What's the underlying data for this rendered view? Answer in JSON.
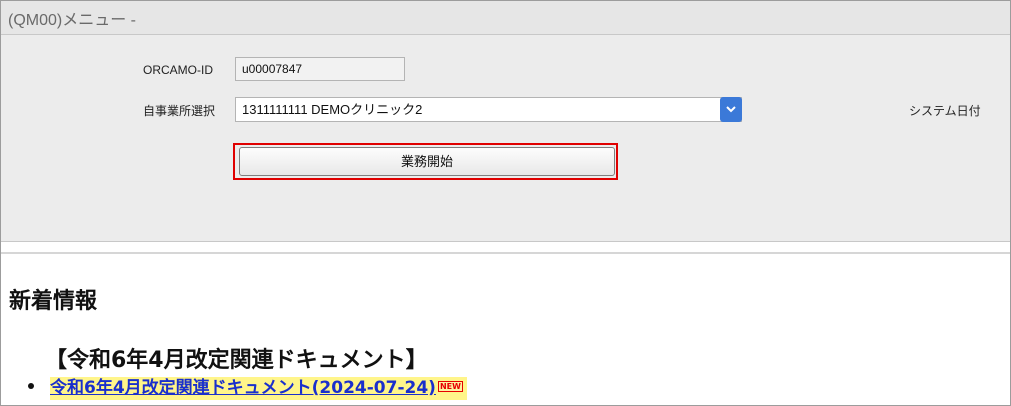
{
  "window": {
    "title": "(QM00)メニュー -"
  },
  "form": {
    "id_label": "ORCAMO-ID",
    "id_value": "u00007847",
    "office_label": "自事業所選択",
    "office_selected": "1311111111 DEMOクリニック2",
    "system_date_label": "システム日付",
    "start_button_label": "業務開始"
  },
  "news": {
    "heading": "新着情報",
    "subheading": "【令和6年4月改定関連ドキュメント】",
    "items": [
      {
        "link_text": "令和6年4月改定関連ドキュメント(2024-07-24)",
        "badge": "NEW"
      }
    ]
  },
  "colors": {
    "highlight_border": "#e00000",
    "dropdown_accent": "#3b79d8",
    "link": "#1a2fcc",
    "link_highlight_bg": "#fff58a"
  }
}
